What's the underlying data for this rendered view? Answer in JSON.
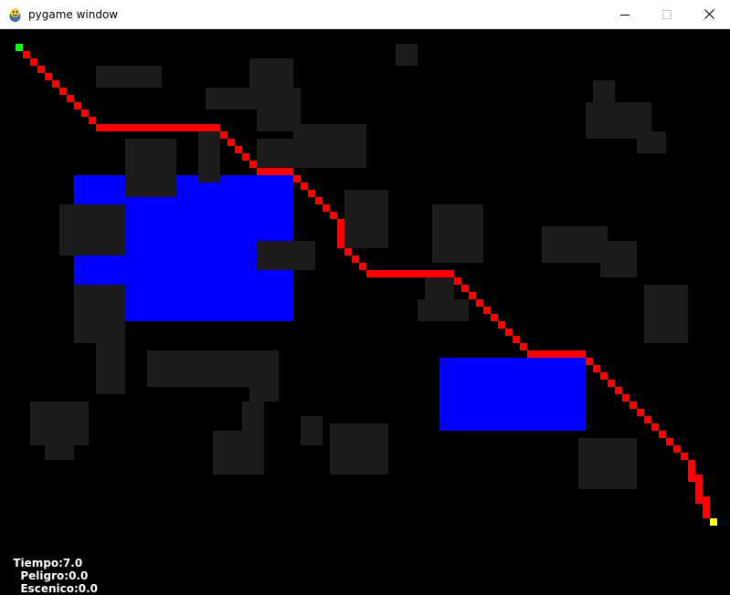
{
  "window": {
    "title": "pygame window",
    "app_icon": "pygame-snake-icon",
    "buttons": [
      {
        "name": "minimize-button",
        "icon": "minimize-icon"
      },
      {
        "name": "maximize-button",
        "icon": "maximize-icon",
        "disabled": true
      },
      {
        "name": "close-button",
        "icon": "close-icon"
      }
    ]
  },
  "colors": {
    "background": "#000000",
    "obstacle": "#1b1b1b",
    "water": "#0000ff",
    "path": "#ff0000",
    "start": "#00ff00",
    "goal": "#ffff00",
    "text": "#ffffff"
  },
  "status": {
    "tiempo": "Tiempo:7.0",
    "peligro": "Peligro:0.0",
    "escenico": "Escenico:0.0"
  }
}
